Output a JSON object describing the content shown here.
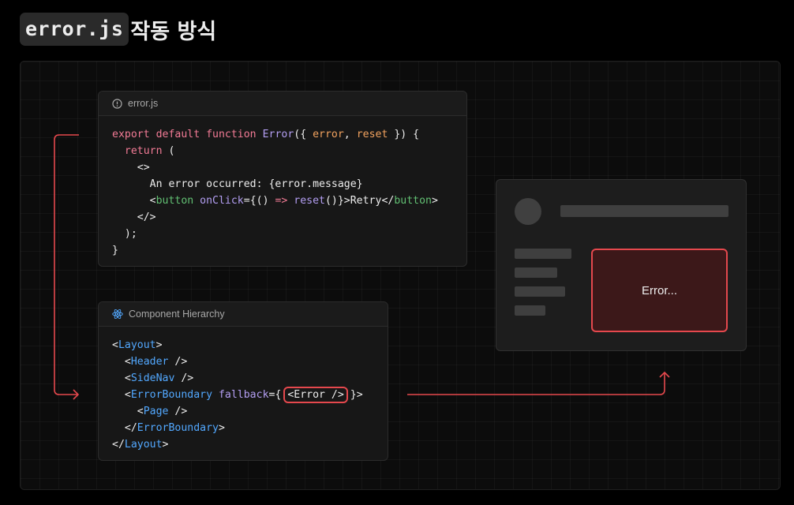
{
  "heading": {
    "code": "error.js",
    "text": "작동 방식"
  },
  "error_file": {
    "title": "error.js",
    "lines": [
      [
        {
          "t": "export default function ",
          "c": "kw"
        },
        {
          "t": "Error",
          "c": "fn"
        },
        {
          "t": "({ ",
          "c": "dim"
        },
        {
          "t": "error",
          "c": "arg"
        },
        {
          "t": ", ",
          "c": "dim"
        },
        {
          "t": "reset",
          "c": "arg"
        },
        {
          "t": " }) {",
          "c": "dim"
        }
      ],
      [
        {
          "t": "  return",
          "c": "kw"
        },
        {
          "t": " (",
          "c": "dim"
        }
      ],
      [
        {
          "t": "    <>",
          "c": "dim"
        }
      ],
      [
        {
          "t": "      An error occurred: {error.message}",
          "c": "dim"
        }
      ],
      [
        {
          "t": "      <",
          "c": "dim"
        },
        {
          "t": "button",
          "c": "grn"
        },
        {
          "t": " onClick",
          "c": "attr"
        },
        {
          "t": "={() ",
          "c": "dim"
        },
        {
          "t": "=>",
          "c": "kw"
        },
        {
          "t": " reset",
          "c": "fn"
        },
        {
          "t": "()}>Retry</",
          "c": "dim"
        },
        {
          "t": "button",
          "c": "grn"
        },
        {
          "t": ">",
          "c": "dim"
        }
      ],
      [
        {
          "t": "    </>",
          "c": "dim"
        }
      ],
      [
        {
          "t": "  );",
          "c": "dim"
        }
      ],
      [
        {
          "t": "}",
          "c": "dim"
        }
      ]
    ]
  },
  "hierarchy": {
    "title": "Component Hierarchy",
    "lines": [
      [
        {
          "t": "<",
          "c": "dim"
        },
        {
          "t": "Layout",
          "c": "tag"
        },
        {
          "t": ">",
          "c": "dim"
        }
      ],
      [
        {
          "t": "  <",
          "c": "dim"
        },
        {
          "t": "Header",
          "c": "tag"
        },
        {
          "t": " />",
          "c": "dim"
        }
      ],
      [
        {
          "t": "  <",
          "c": "dim"
        },
        {
          "t": "SideNav",
          "c": "tag"
        },
        {
          "t": " />",
          "c": "dim"
        }
      ],
      [
        {
          "t": "  <",
          "c": "dim"
        },
        {
          "t": "ErrorBoundary",
          "c": "tag"
        },
        {
          "t": " fallback",
          "c": "attr"
        },
        {
          "t": "={ ",
          "c": "dim"
        },
        {
          "t": "<Error />",
          "c": "hl"
        },
        {
          "t": " }>",
          "c": "dim"
        }
      ],
      [
        {
          "t": "    <",
          "c": "dim"
        },
        {
          "t": "Page",
          "c": "tag"
        },
        {
          "t": " />",
          "c": "dim"
        }
      ],
      [
        {
          "t": "  </",
          "c": "dim"
        },
        {
          "t": "ErrorBoundary",
          "c": "tag"
        },
        {
          "t": ">",
          "c": "dim"
        }
      ],
      [
        {
          "t": "</",
          "c": "dim"
        },
        {
          "t": "Layout",
          "c": "tag"
        },
        {
          "t": ">",
          "c": "dim"
        }
      ]
    ]
  },
  "preview": {
    "error_label": "Error..."
  },
  "colors": {
    "accent": "#e5484d",
    "tag": "#52a8ff",
    "keyword": "#f37b96",
    "function": "#b39ef2",
    "arg": "#f3a35f"
  }
}
